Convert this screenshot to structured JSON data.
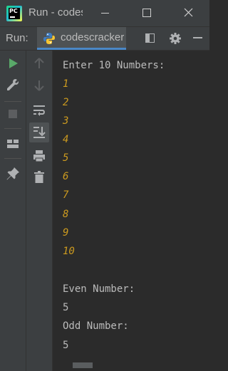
{
  "window": {
    "title": "Run - codescracker",
    "app_icon_text": "PC"
  },
  "run_panel": {
    "label": "Run:",
    "tab_name": "codescracker"
  },
  "console": {
    "truncated_top": "’  ’",
    "prompt": "Enter 10 Numbers:",
    "inputs": [
      "1",
      "2",
      "3",
      "4",
      "5",
      "6",
      "7",
      "8",
      "9",
      "10"
    ],
    "even_label": "Even Number:",
    "even_count": "5",
    "odd_label": "Odd Number:",
    "odd_count": "5"
  },
  "colors": {
    "console_bg": "#2b2b2b",
    "toolbar_bg": "#3c3f41",
    "output_text": "#bbbbbb",
    "user_input_text": "#cc9a1f",
    "run_green": "#59a869",
    "tab_underline": "#4a88c7"
  },
  "icons": {
    "outer_toolbar": [
      "run-icon",
      "wrench-icon",
      "stop-icon",
      "layout-icon",
      "pin-icon"
    ],
    "inner_toolbar": [
      "arrow-up-icon",
      "arrow-down-icon",
      "soft-wrap-icon",
      "scroll-to-end-icon",
      "print-icon",
      "trash-icon"
    ]
  }
}
